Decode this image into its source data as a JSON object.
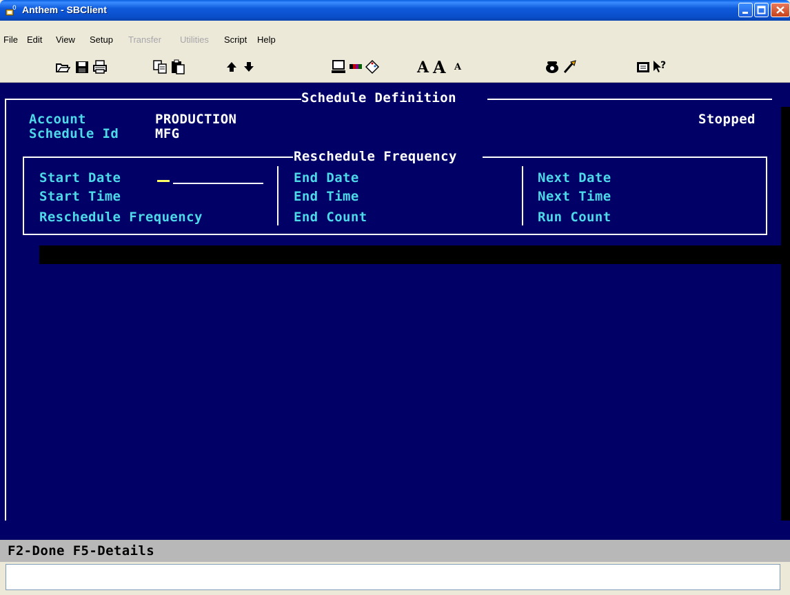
{
  "window": {
    "title": "Anthem - SBClient"
  },
  "menu": {
    "items": [
      {
        "label": "File",
        "enabled": true
      },
      {
        "label": "Edit",
        "enabled": true
      },
      {
        "label": "View",
        "enabled": true
      },
      {
        "label": "Setup",
        "enabled": true
      },
      {
        "label": "Transfer",
        "enabled": false
      },
      {
        "label": "Utilities",
        "enabled": false
      },
      {
        "label": "Script",
        "enabled": true
      },
      {
        "label": "Help",
        "enabled": true
      }
    ]
  },
  "toolbar": {
    "icons": [
      "open-icon",
      "save-icon",
      "print-icon",
      "copy-icon",
      "paste-icon",
      "up-arrow-icon",
      "down-arrow-icon",
      "terminal-icon",
      "colors-icon",
      "palette-icon",
      "font-normal-icon",
      "font-larger-icon",
      "font-smaller-icon",
      "phone-icon",
      "brush-icon",
      "keyboard-icon",
      "help-pointer-icon"
    ],
    "font_normal_label": "A",
    "font_larger_label": "A",
    "font_smaller_label": "A"
  },
  "terminal": {
    "header_title": "Schedule Definition",
    "account_label": "Account",
    "account_value": "PRODUCTION",
    "schedule_id_label": "Schedule Id",
    "schedule_id_value": "MFG",
    "status": "Stopped",
    "frequency_box_title": "Reschedule Frequency",
    "col1": {
      "start_date": "Start Date",
      "start_time": "Start Time",
      "reschedule_frequency": "Reschedule Frequency"
    },
    "col2": {
      "end_date": "End Date",
      "end_time": "End Time",
      "end_count": "End Count"
    },
    "col3": {
      "next_date": "Next Date",
      "next_time": "Next Time",
      "run_count": "Run Count"
    },
    "colors": {
      "background": "#000066",
      "label": "#4DD9E8",
      "value": "#FFFFFF",
      "cursor": "#FFFF66"
    }
  },
  "status_bar": {
    "keys": "F2-Done F5-Details"
  },
  "command_input": {
    "value": ""
  }
}
